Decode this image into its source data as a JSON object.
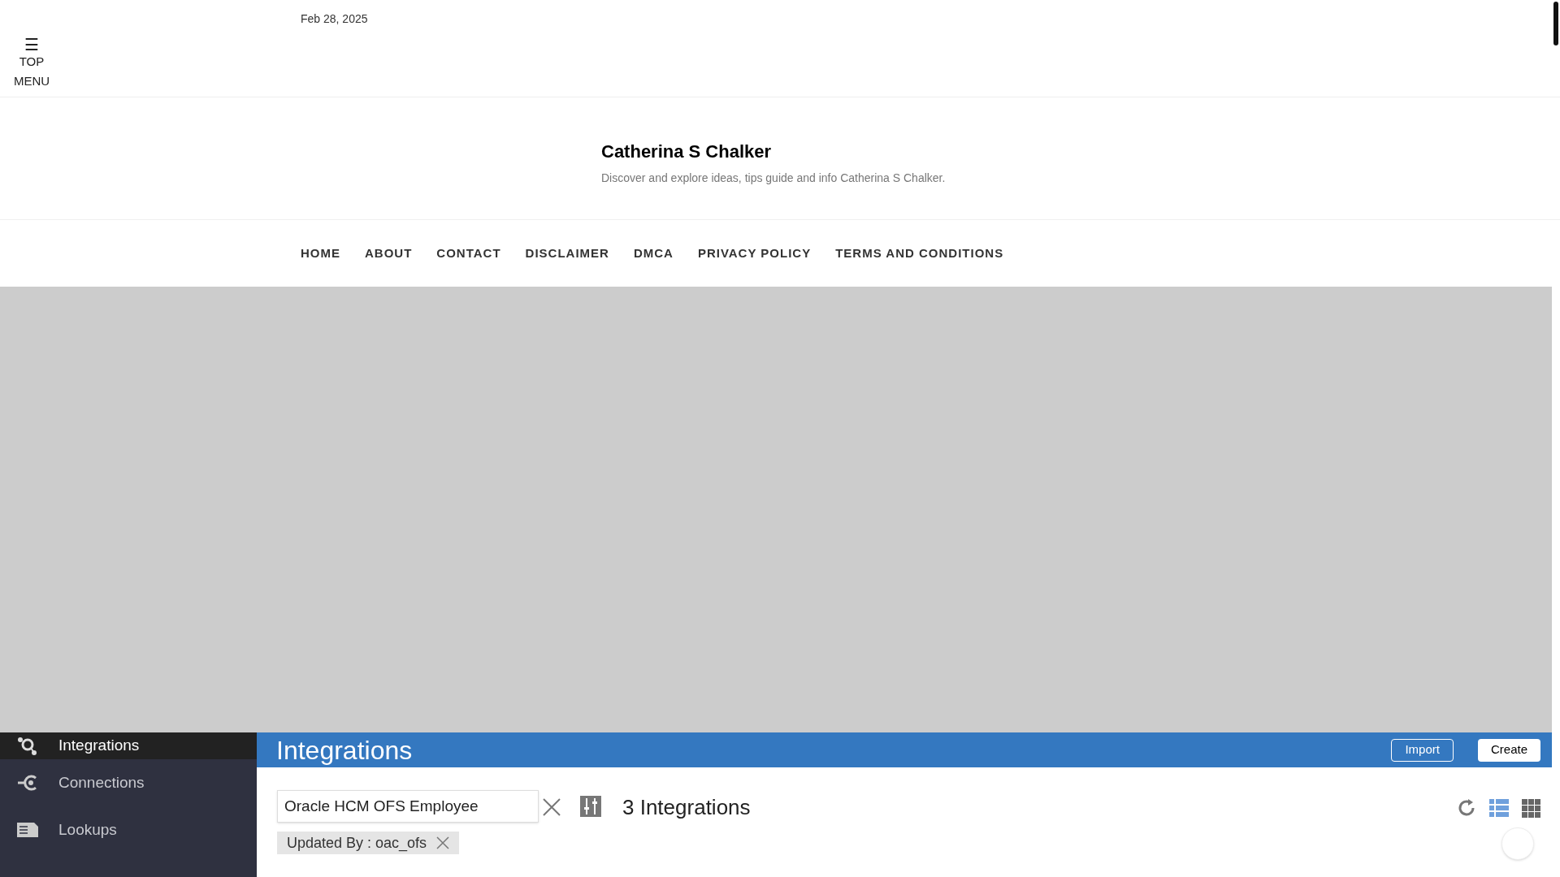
{
  "date": "Feb 28, 2025",
  "top_menu": {
    "icon": "☰",
    "label_1": "TOP",
    "label_2": "MENU"
  },
  "site": {
    "title": "Catherina S Chalker",
    "tagline": "Discover and explore ideas, tips guide and info Catherina S Chalker."
  },
  "nav": [
    "HOME",
    "ABOUT",
    "CONTACT",
    "DISCLAIMER",
    "DMCA",
    "PRIVACY POLICY",
    "TERMS AND CONDITIONS"
  ],
  "screenshot": {
    "sidebar": [
      {
        "label": "Integrations",
        "selected": true
      },
      {
        "label": "Connections",
        "selected": false
      },
      {
        "label": "Lookups",
        "selected": false
      }
    ],
    "header_title": "Integrations",
    "buttons": [
      {
        "label": "Import",
        "kind": "outline"
      },
      {
        "label": "Create",
        "kind": "solid"
      }
    ],
    "search": {
      "value": "Oracle HCM OFS Employee"
    },
    "count": "3 Integrations",
    "filter_tag": "Updated By : oac_ofs",
    "views": [
      {
        "kind": "list",
        "selected": true
      },
      {
        "kind": "grid",
        "selected": false
      }
    ]
  }
}
